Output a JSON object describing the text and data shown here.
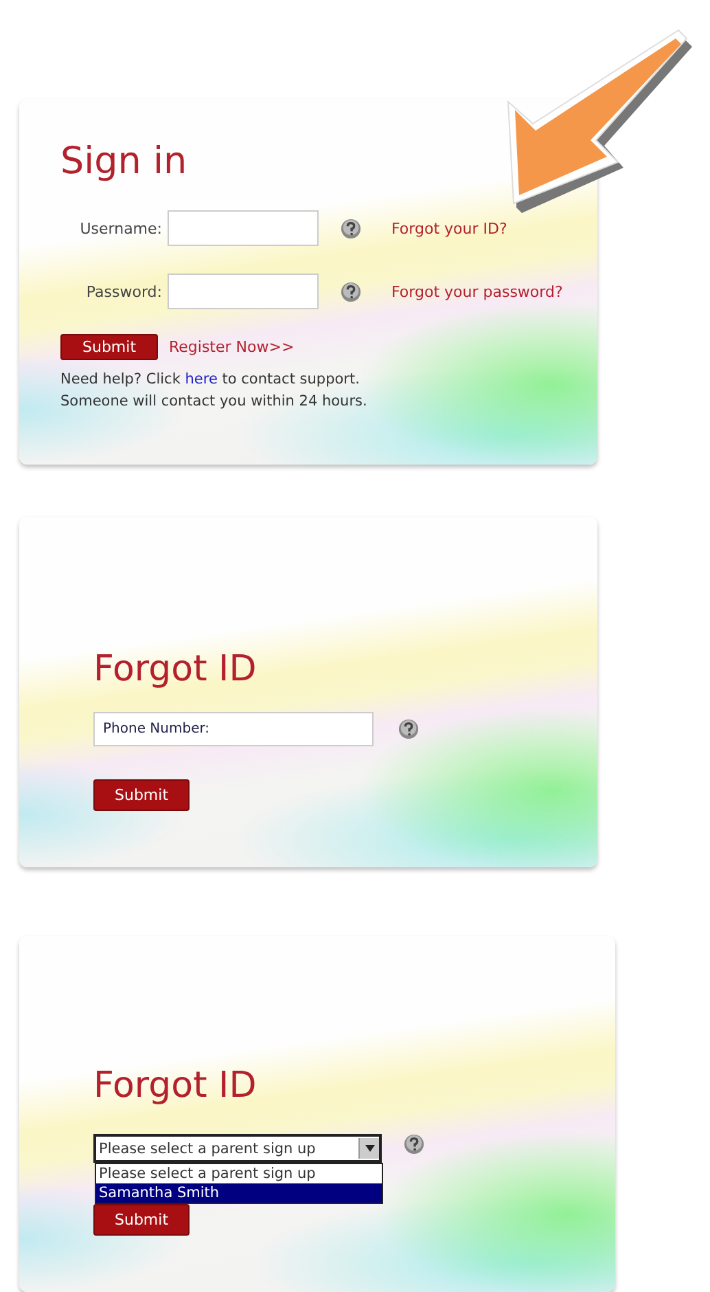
{
  "sign_in": {
    "title": "Sign in",
    "fields": [
      {
        "label": "Username:",
        "link": "Forgot your ID?"
      },
      {
        "label": "Password:",
        "link": "Forgot your password?"
      }
    ],
    "submit": "Submit",
    "register_link": "Register Now>>",
    "help": {
      "before": "Need help? Click",
      "link": "here",
      "after": "to contact support."
    },
    "note": "Someone will contact you within 24 hours."
  },
  "forgot_id_phone": {
    "title": "Forgot ID",
    "phone": {
      "placeholder": "Phone Number:"
    },
    "submit": "Submit"
  },
  "forgot_id_select": {
    "title": "Forgot ID",
    "select": {
      "value": "Please select a parent sign up",
      "expanded": true,
      "options": [
        {
          "label": "Please select a parent sign up",
          "highlighted": false
        },
        {
          "label": "Samantha Smith",
          "highlighted": true
        }
      ]
    },
    "submit": "Submit"
  }
}
